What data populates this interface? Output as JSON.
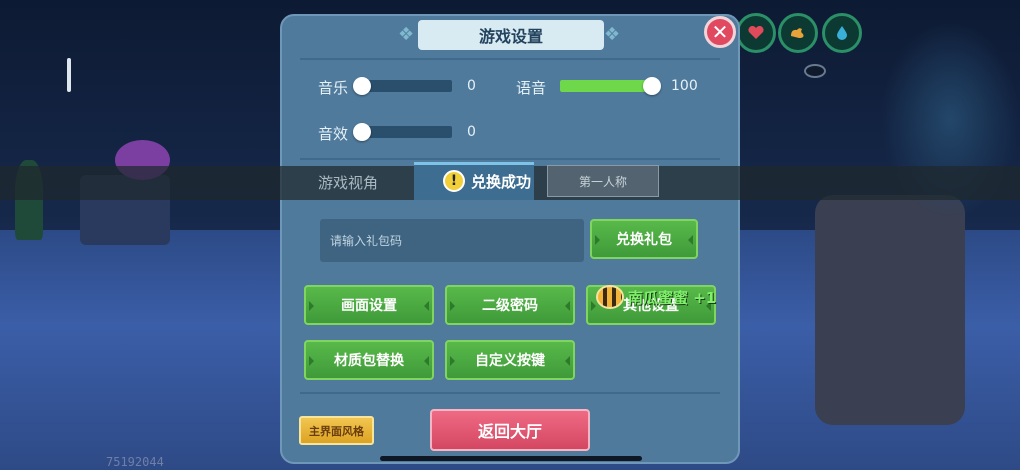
{
  "dialog": {
    "title": "游戏设置",
    "close_label": "✕"
  },
  "audio": {
    "music_label": "音乐",
    "music_value": "0",
    "music_level": 0,
    "voice_label": "语音",
    "voice_value": "100",
    "voice_level": 1.0,
    "sfx_label": "音效",
    "sfx_value": "0",
    "sfx_level": 0
  },
  "view": {
    "label": "游戏视角",
    "option_first_person": "第一人称"
  },
  "toast": {
    "icon": "warning-icon",
    "text": "兑换成功"
  },
  "gift": {
    "placeholder": "请输入礼包码",
    "redeem_label": "兑换礼包"
  },
  "buttons": {
    "graphics": "画面设置",
    "secondary_password": "二级密码",
    "other": "其他设置",
    "texture_pack": "材质包替换",
    "custom_keys": "自定义按键"
  },
  "reward": {
    "icon": "bee-icon",
    "text": "南瓜蜜蜜 +1"
  },
  "footer": {
    "style_label": "主界面风格",
    "back_label": "返回大厅"
  },
  "hud": {
    "uid": "75192044",
    "icons": [
      "heart-icon",
      "muscle-icon",
      "water-drop-icon"
    ]
  },
  "colors": {
    "panel": "#4f7a9c",
    "green_button": "#4caa40",
    "back_button": "#e05a74",
    "style_button": "#e8b53a",
    "slider_fill": "#6fd84a"
  }
}
